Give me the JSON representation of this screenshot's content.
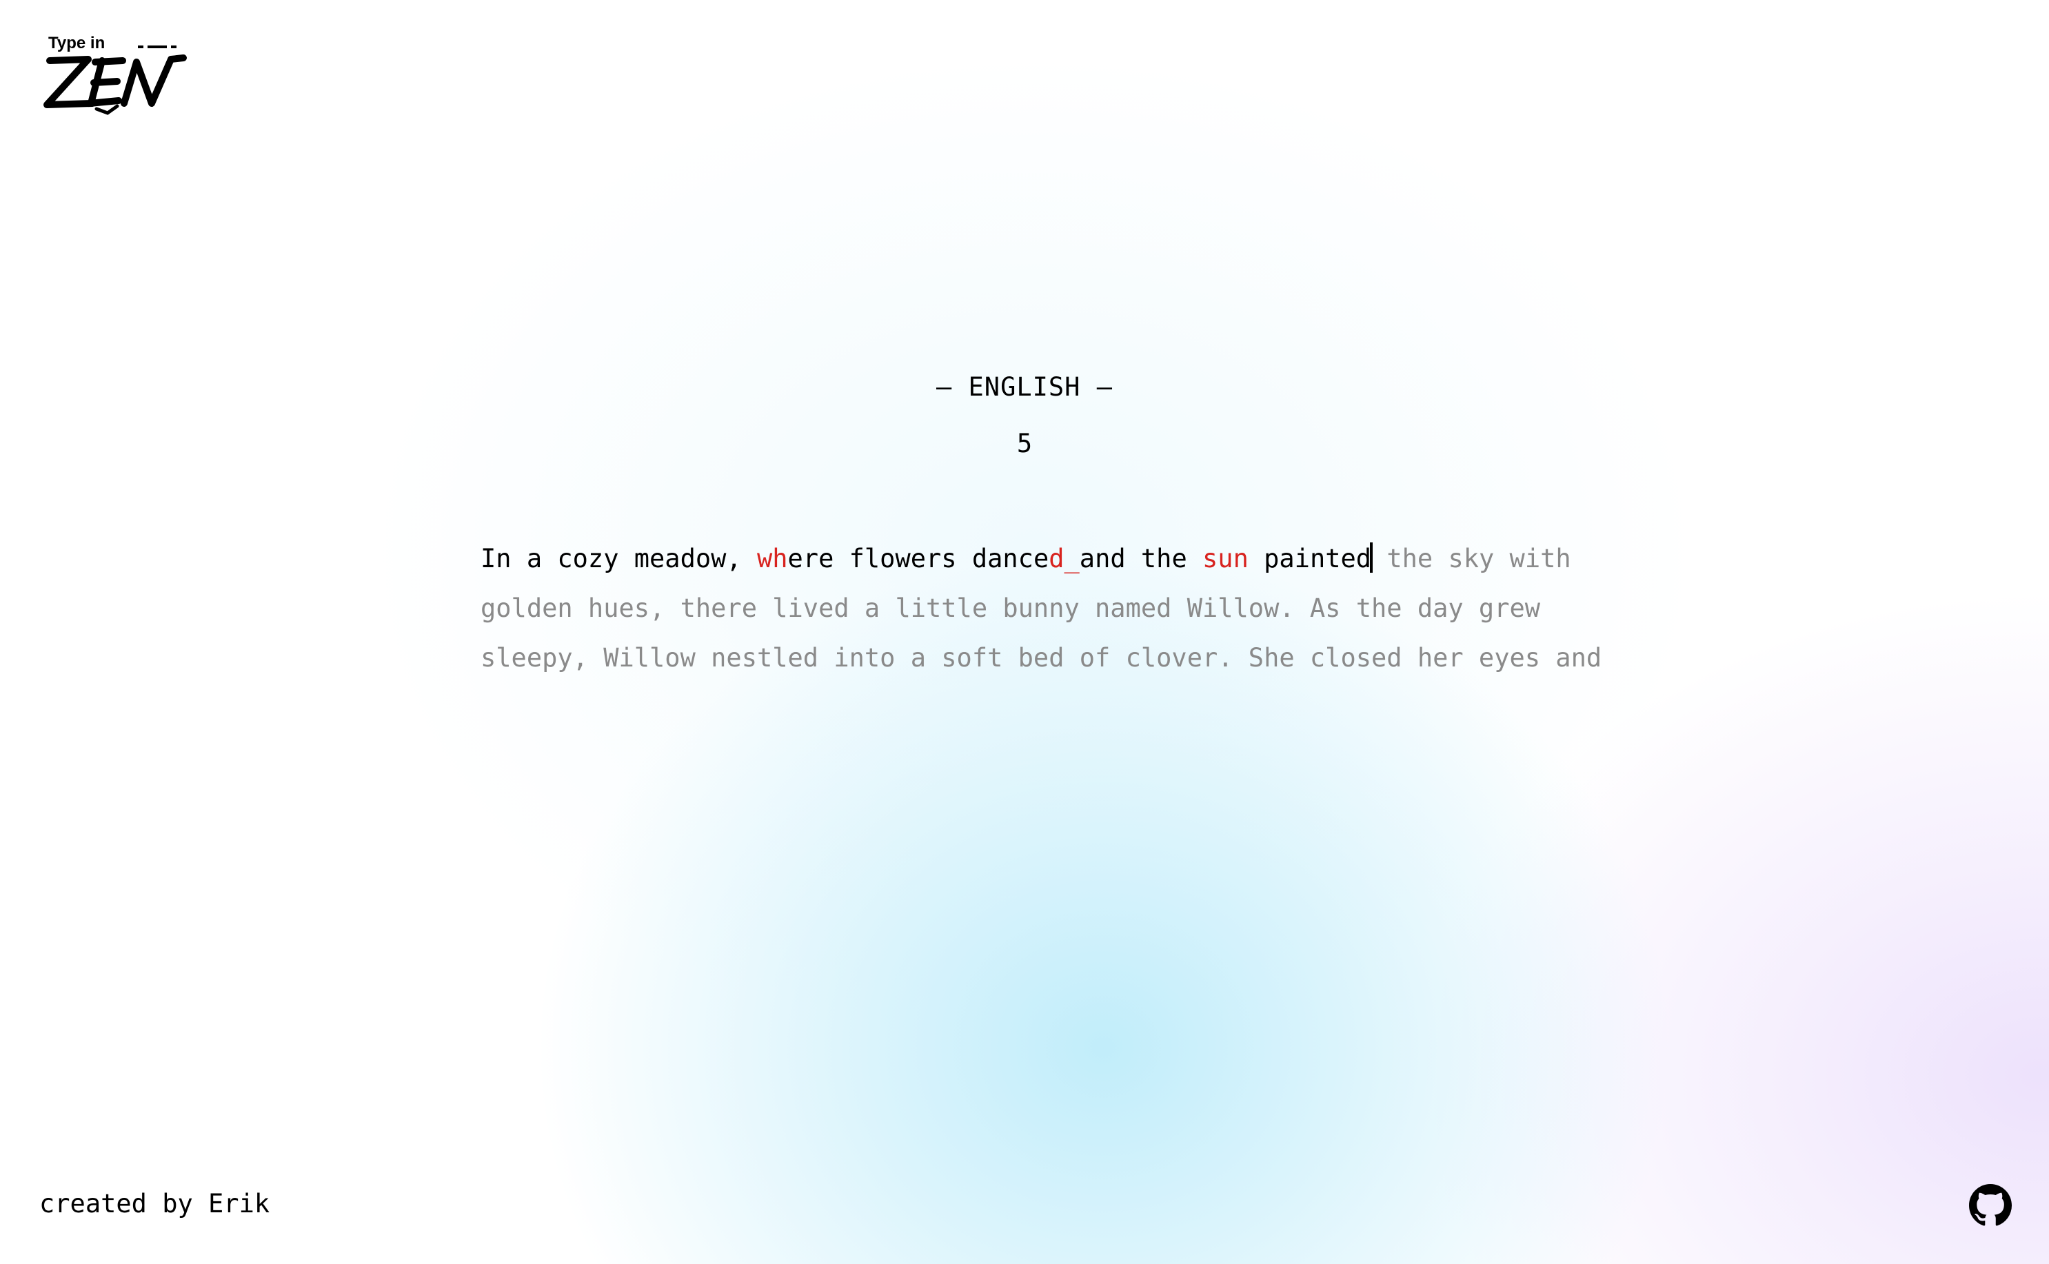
{
  "logo": {
    "small_text": "Type in",
    "big_text": "ZEN"
  },
  "mode": {
    "title": "– ENGLISH –",
    "count": "5"
  },
  "typing": {
    "lines": [
      [
        {
          "text": "In a cozy meadow, ",
          "state": "correct"
        },
        {
          "text": "wh",
          "state": "wrong"
        },
        {
          "text": "ere flowers dance",
          "state": "correct"
        },
        {
          "text": "d_",
          "state": "wrong"
        },
        {
          "text": "and the ",
          "state": "correct"
        },
        {
          "text": "sun",
          "state": "wrong"
        },
        {
          "text": " painted",
          "state": "correct"
        },
        {
          "text": "",
          "state": "caret"
        },
        {
          "text": " the sky with",
          "state": "pending"
        }
      ],
      [
        {
          "text": "golden hues, there lived a little bunny named Willow. As the day grew",
          "state": "pending"
        }
      ],
      [
        {
          "text": "sleepy, Willow nestled into a soft bed of clover. She closed her eyes and",
          "state": "pending"
        }
      ]
    ]
  },
  "footer": {
    "credit": "created by Erik",
    "github_icon": "github-icon"
  },
  "colors": {
    "correct": "#000000",
    "wrong": "#d8231f",
    "pending": "#8a8a8a",
    "accent_blue": "#c6ecfa",
    "accent_purple": "#ece0fc"
  }
}
